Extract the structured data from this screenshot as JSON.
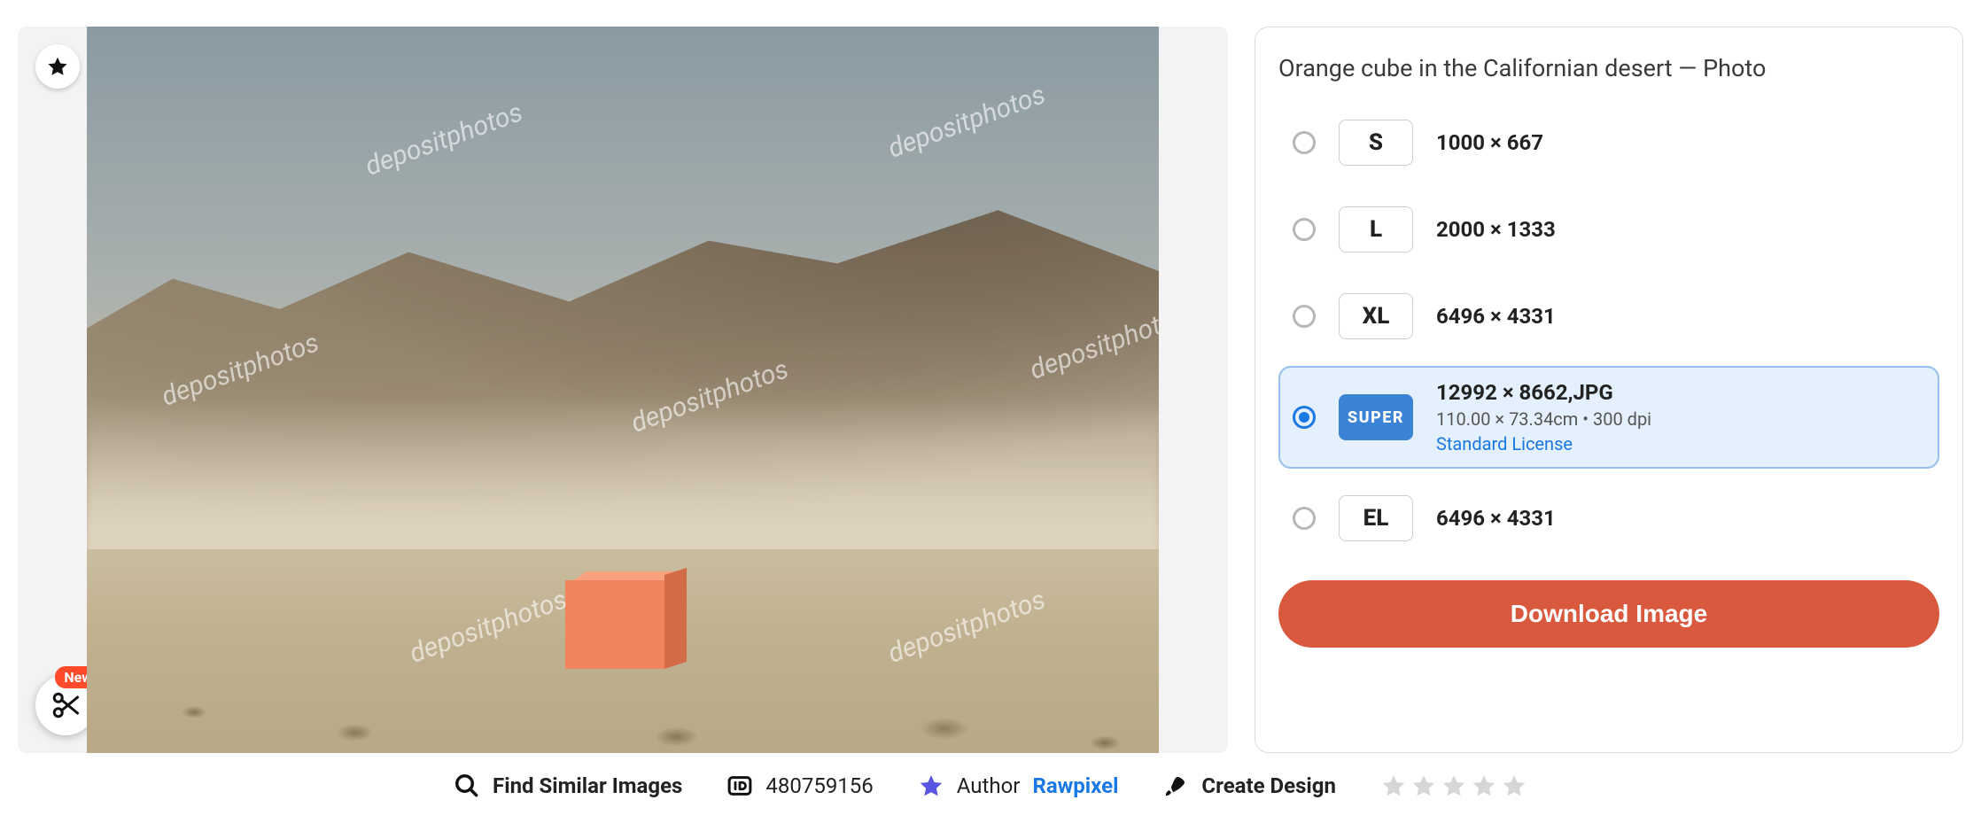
{
  "title": "Orange cube in the Californian desert — Photo",
  "watermark_text": "depositphotos",
  "favorite": {
    "tooltip": "Add to favorites"
  },
  "crop": {
    "new_badge": "New"
  },
  "sizes": [
    {
      "code": "S",
      "chip_class": "",
      "dimensions": "1000 × 667",
      "selected": false
    },
    {
      "code": "L",
      "chip_class": "",
      "dimensions": "2000 × 1333",
      "selected": false
    },
    {
      "code": "XL",
      "chip_class": "",
      "dimensions": "6496 × 4331",
      "selected": false
    },
    {
      "code": "SUPER",
      "chip_class": "super",
      "dimensions": "12992 × 8662,JPG",
      "physical": "110.00 × 73.34cm • 300 dpi",
      "license": "Standard License",
      "selected": true
    },
    {
      "code": "EL",
      "chip_class": "",
      "dimensions": "6496 × 4331",
      "selected": false
    }
  ],
  "download_label": "Download Image",
  "toolbar": {
    "similar": "Find Similar Images",
    "id_label": "ID",
    "id_value": "480759156",
    "author_label": "Author",
    "author_name": "Rawpixel",
    "create": "Create Design"
  },
  "rating": {
    "score": 0,
    "max": 5
  }
}
